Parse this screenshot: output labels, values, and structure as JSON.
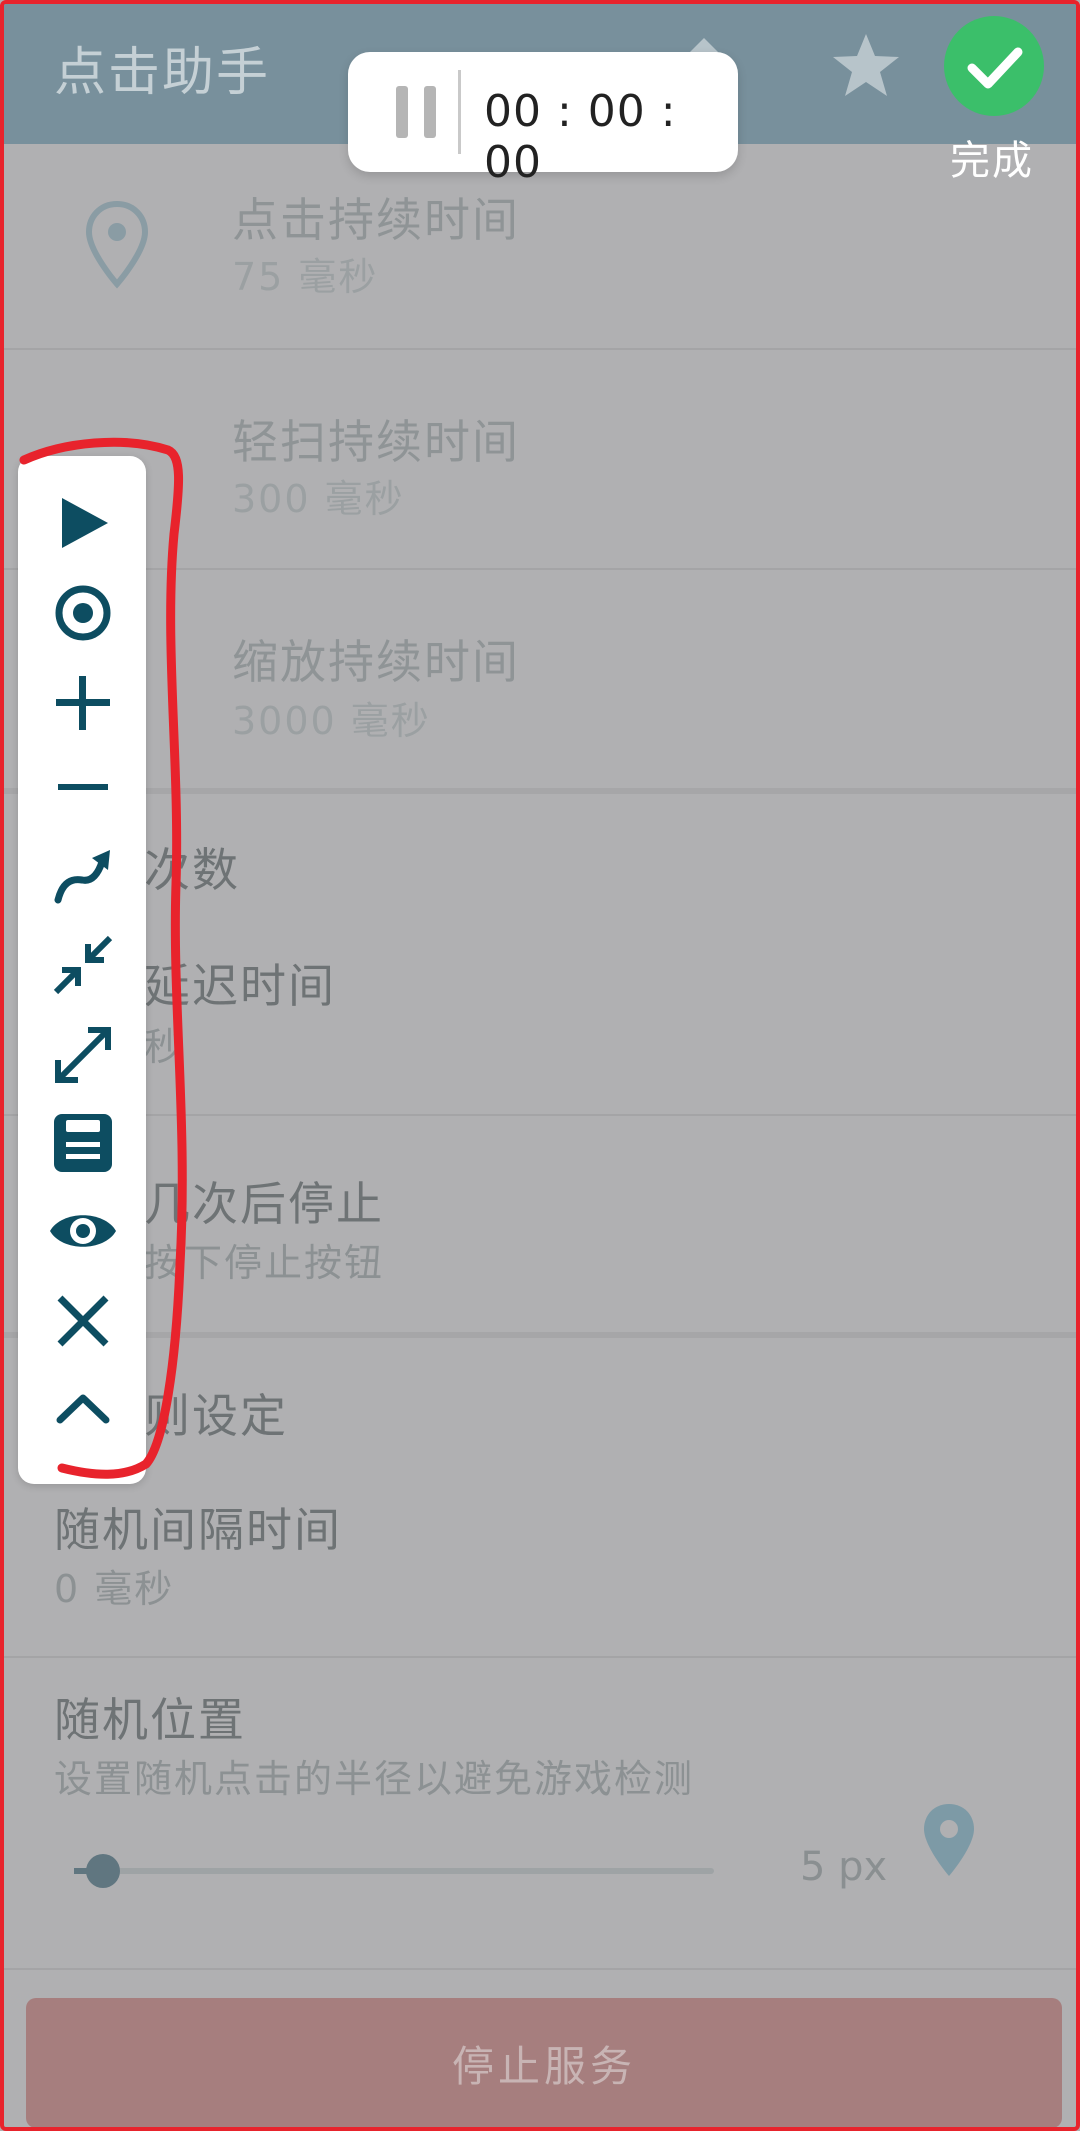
{
  "app": {
    "title": "点击助手"
  },
  "timer": {
    "time": "00 : 00 : 00"
  },
  "done": {
    "label": "完成"
  },
  "rows": [
    {
      "title": "点击持续时间",
      "subtitle": "75 毫秒"
    },
    {
      "title": "轻扫持续时间",
      "subtitle": "300 毫秒"
    },
    {
      "title": "缩放持续时间",
      "subtitle": "3000 毫秒"
    }
  ],
  "partial": {
    "count_header": "次数",
    "delay_title": "延迟时间",
    "delay_sub": "秒",
    "stop_title": "几次后停止",
    "stop_sub": "按下停止按钮",
    "rules_header": "则设定"
  },
  "random_interval": {
    "title": "随机间隔时间",
    "subtitle": "0 毫秒"
  },
  "random_position": {
    "title": "随机位置",
    "subtitle": "设置随机点击的半径以避免游戏检测",
    "value": "5 px",
    "slider_fraction": 0.02
  },
  "stop_button": {
    "label": "停止服务"
  },
  "toolbar_icons": [
    "play-icon",
    "target-icon",
    "plus-icon",
    "minus-icon",
    "swipe-icon",
    "pinch-icon",
    "zoom-icon",
    "save-icon",
    "eye-icon",
    "close-icon",
    "chevron-up-icon"
  ],
  "colors": {
    "accent": "#0d4d61",
    "appbar": "#78909c",
    "done": "#3bbf6a",
    "annotation": "#e8232c"
  }
}
